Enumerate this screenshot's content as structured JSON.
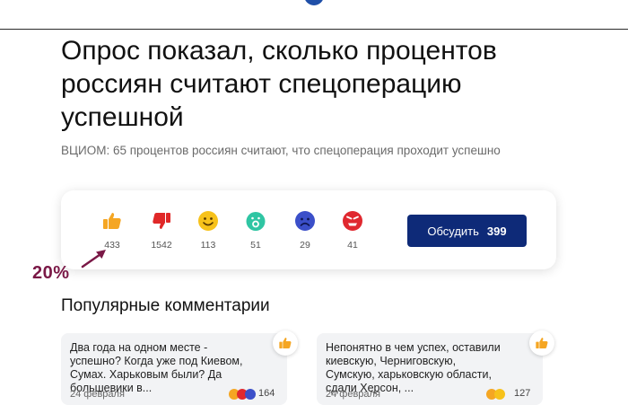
{
  "article": {
    "headline": "Опрос показал, сколько процентов россиян считают спецоперацию успешной",
    "subtitle": "ВЦИОМ: 65 процентов россиян считают, что спецоперация проходит успешно"
  },
  "reactions": [
    {
      "icon": "thumbs-up-icon",
      "count": "433",
      "color": "#f5a623"
    },
    {
      "icon": "thumbs-down-icon",
      "count": "1542",
      "color": "#e02828"
    },
    {
      "icon": "smile-icon",
      "count": "113",
      "color": "#f7c21b"
    },
    {
      "icon": "surprised-icon",
      "count": "51",
      "color": "#2fc5a3"
    },
    {
      "icon": "sad-icon",
      "count": "29",
      "color": "#3b4fc9"
    },
    {
      "icon": "angry-icon",
      "count": "41",
      "color": "#e0282f"
    }
  ],
  "discuss": {
    "label": "Обсудить",
    "count": "399",
    "color": "#0e2a78"
  },
  "annotation": {
    "label": "20%",
    "color": "#7a1846"
  },
  "comments_section": {
    "title": "Популярные комментарии",
    "items": [
      {
        "text": "Два года на одном месте - успешно? Когда уже под Киевом, Сумах. Харьковым были? Да большевики в...",
        "date": "24 февраля",
        "likes": "164"
      },
      {
        "text": "Непонятно в чем успех, оставили киевскую, Черниговскую, Сумскую, харьковскую области, сдали Херсон, ...",
        "date": "24 февраля",
        "likes": "127"
      }
    ]
  }
}
